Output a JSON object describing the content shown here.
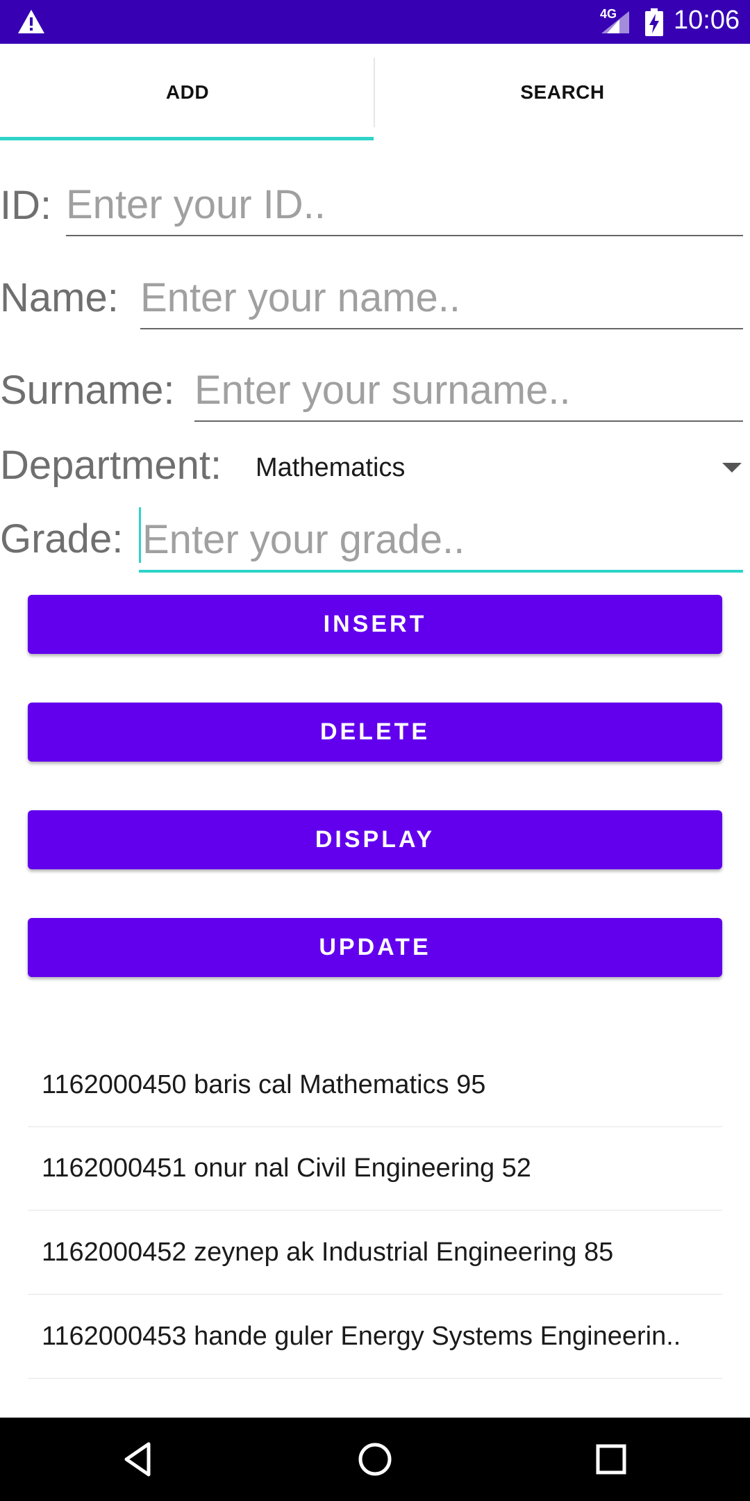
{
  "status_bar": {
    "network": "4G",
    "time": "10:06",
    "icons": [
      "warning-icon",
      "signal-icon",
      "battery-charging-icon"
    ]
  },
  "tabs": [
    {
      "label": "ADD",
      "selected": true
    },
    {
      "label": "SEARCH",
      "selected": false
    }
  ],
  "form": {
    "id": {
      "label": "ID:",
      "placeholder": "Enter your ID..",
      "value": ""
    },
    "name": {
      "label": "Name:",
      "placeholder": "Enter your name..",
      "value": ""
    },
    "surname": {
      "label": "Surname:",
      "placeholder": "Enter your surname..",
      "value": ""
    },
    "department": {
      "label": "Department:",
      "selected": "Mathematics"
    },
    "grade": {
      "label": "Grade:",
      "placeholder": "Enter your grade..",
      "value": ""
    }
  },
  "buttons": {
    "insert": "INSERT",
    "delete": "DELETE",
    "display": "DISPLAY",
    "update": "UPDATE"
  },
  "records": [
    "1162000450 baris cal Mathematics 95",
    "1162000451 onur nal Civil Engineering 52",
    "1162000452 zeynep ak Industrial Engineering 85",
    "1162000453 hande guler Energy Systems Engineerin.."
  ],
  "colors": {
    "status_bar": "#3700b3",
    "primary": "#6200ee",
    "accent": "#2dd4c8"
  },
  "nav_bar": [
    "back-icon",
    "home-icon",
    "recents-icon"
  ]
}
